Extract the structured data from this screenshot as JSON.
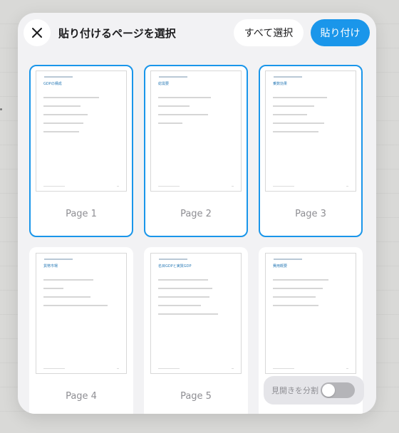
{
  "header": {
    "close_icon": "close-icon",
    "title": "貼り付けるページを選択",
    "select_all_label": "すべて選択",
    "paste_label": "貼り付け"
  },
  "colors": {
    "accent": "#1a96ea",
    "modal_bg": "#f2f2f4",
    "label_gray": "#8e8e93"
  },
  "pages": [
    {
      "label": "Page 1",
      "heading": "GDPの構成",
      "selected": true
    },
    {
      "label": "Page 2",
      "heading": "総需要",
      "selected": true
    },
    {
      "label": "Page 3",
      "heading": "乗数効果",
      "selected": true
    },
    {
      "label": "Page 4",
      "heading": "貨幣市場",
      "selected": false
    },
    {
      "label": "Page 5",
      "heading": "名目GDPと実質GDP",
      "selected": false
    },
    {
      "label": "",
      "heading": "費用概要",
      "selected": false
    }
  ],
  "spread": {
    "label": "見開きを分割",
    "enabled": false
  }
}
